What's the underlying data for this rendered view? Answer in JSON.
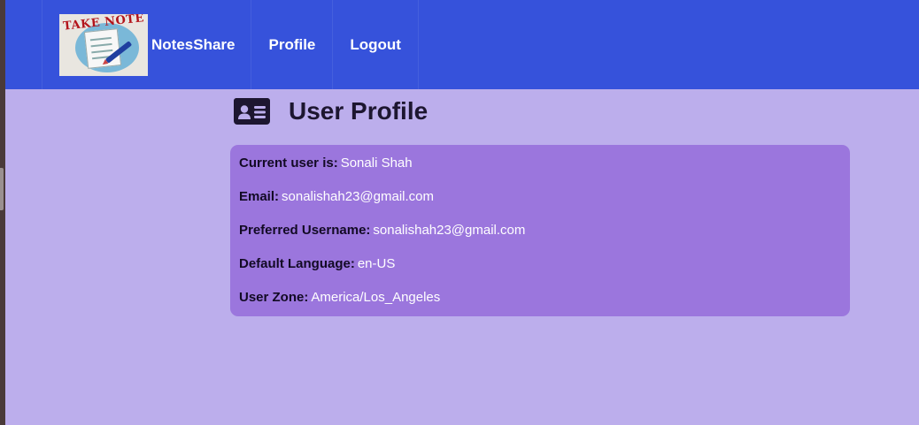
{
  "nav": {
    "logo_text": "TAKE NOTE",
    "brand": "NotesShare",
    "links": [
      {
        "label": "Profile"
      },
      {
        "label": "Logout"
      }
    ]
  },
  "icons": {
    "heading": "id-card-icon"
  },
  "page": {
    "title": "User Profile"
  },
  "profile": [
    {
      "label": "Current user is:",
      "value": "Sonali Shah"
    },
    {
      "label": "Email:",
      "value": "sonalishah23@gmail.com"
    },
    {
      "label": "Preferred Username:",
      "value": "sonalishah23@gmail.com"
    },
    {
      "label": "Default Language:",
      "value": "en-US"
    },
    {
      "label": "User Zone:",
      "value": "America/Los_Angeles"
    }
  ],
  "colors": {
    "navbar": "#3652db",
    "background": "#bcaeec",
    "card": "#9b76dd"
  }
}
